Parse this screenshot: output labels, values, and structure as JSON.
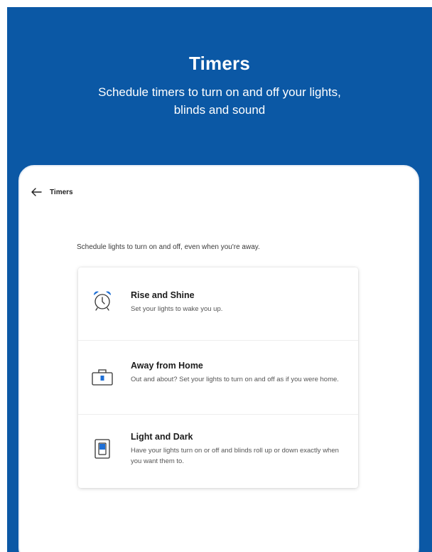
{
  "hero": {
    "title": "Timers",
    "subtitle": "Schedule timers to turn on and off your lights, blinds and sound"
  },
  "app_bar": {
    "back_icon": "arrow-left-icon",
    "title": "Timers"
  },
  "intro": "Schedule lights to turn on and off, even when you're away.",
  "options": [
    {
      "title": "Rise and Shine",
      "description": "Set your lights to wake you up.",
      "icon": "alarm-clock-icon"
    },
    {
      "title": "Away from Home",
      "description": "Out and about? Set your lights to turn on and off as if you were home.",
      "icon": "suitcase-icon"
    },
    {
      "title": "Light and Dark",
      "description": "Have your lights turn on or off and blinds roll up or down exactly when you want them to.",
      "icon": "blind-switch-icon"
    }
  ],
  "colors": {
    "brand_blue": "#0b58a5",
    "icon_blue": "#1e6fd6"
  }
}
